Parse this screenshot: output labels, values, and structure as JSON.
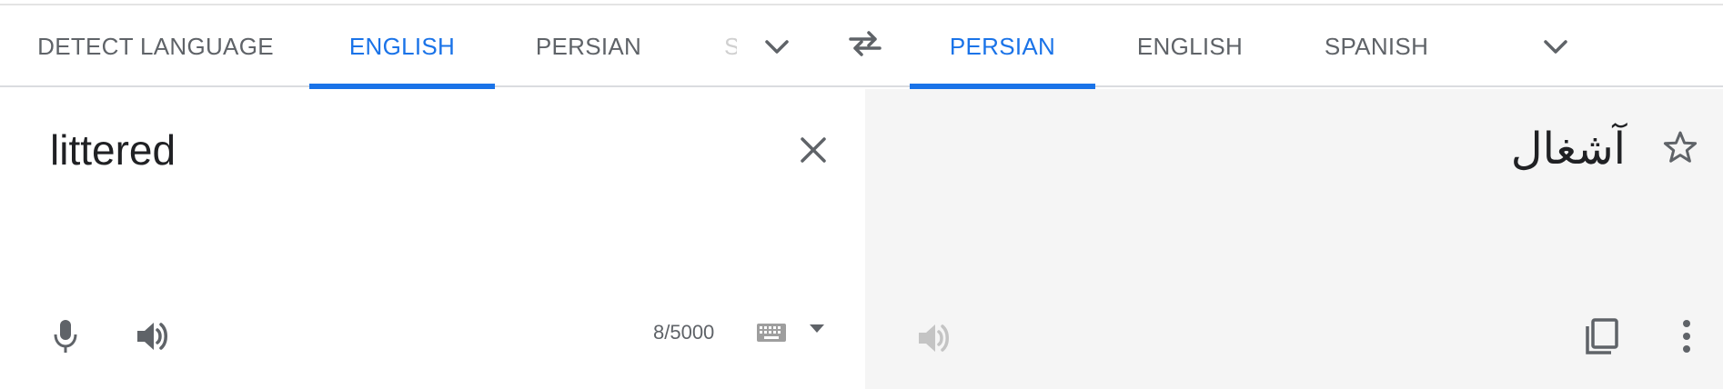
{
  "source_languages": {
    "tabs": [
      {
        "label": "DETECT LANGUAGE",
        "active": false
      },
      {
        "label": "ENGLISH",
        "active": true
      },
      {
        "label": "PERSIAN",
        "active": false
      },
      {
        "label": "SPANISH",
        "active": false,
        "clipped": true
      }
    ],
    "more_icon": "chevron-down-icon"
  },
  "swap_icon": "swap-arrows-icon",
  "target_languages": {
    "tabs": [
      {
        "label": "PERSIAN",
        "active": true
      },
      {
        "label": "ENGLISH",
        "active": false
      },
      {
        "label": "SPANISH",
        "active": false
      }
    ],
    "more_icon": "chevron-down-icon"
  },
  "source": {
    "text": "littered",
    "char_count": "8/5000",
    "icons": [
      "close-icon",
      "microphone-icon",
      "speaker-icon",
      "keyboard-icon",
      "caret-down-icon"
    ]
  },
  "target": {
    "text": "آشغال",
    "icons": [
      "star-icon",
      "speaker-icon",
      "copy-icon",
      "more-vert-icon"
    ]
  },
  "colors": {
    "accent": "#1a73e8",
    "tab_text": "#5f6368",
    "icon": "#5f6368",
    "icon_disabled": "#bdbdbd",
    "target_bg": "#f5f5f5"
  }
}
